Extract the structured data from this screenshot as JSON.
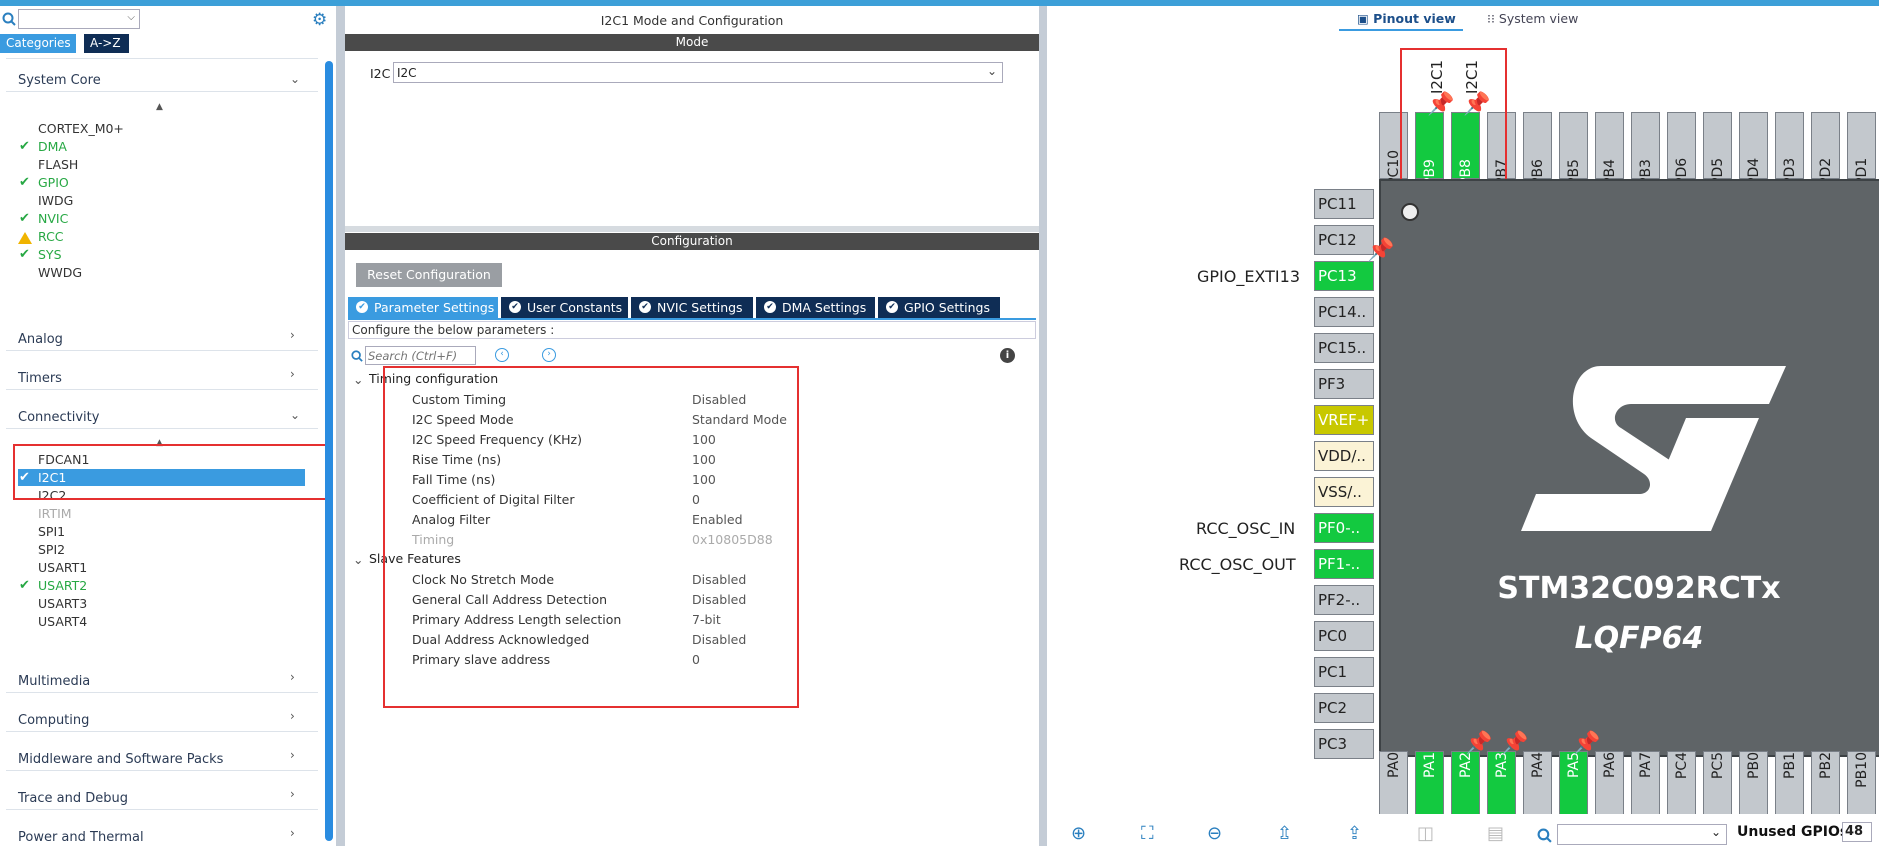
{
  "left": {
    "categories_tab": "Categories",
    "az_tab": "A->Z",
    "sections": {
      "system_core": "System Core",
      "analog": "Analog",
      "timers": "Timers",
      "connectivity": "Connectivity",
      "multimedia": "Multimedia",
      "computing": "Computing",
      "middleware": "Middleware and Software Packs",
      "trace": "Trace and Debug",
      "power": "Power and Thermal"
    },
    "system_core_items": [
      "CORTEX_M0+",
      "DMA",
      "FLASH",
      "GPIO",
      "IWDG",
      "NVIC",
      "RCC",
      "SYS",
      "WWDG"
    ],
    "connectivity_items": [
      "FDCAN1",
      "I2C1",
      "I2C2",
      "IRTIM",
      "SPI1",
      "SPI2",
      "USART1",
      "USART2",
      "USART3",
      "USART4"
    ]
  },
  "mid": {
    "title": "I2C1 Mode and Configuration",
    "mode_header": "Mode",
    "mode_label": "I2C",
    "mode_value": "I2C",
    "config_header": "Configuration",
    "reset_btn": "Reset Configuration",
    "tabs": [
      "Parameter Settings",
      "User Constants",
      "NVIC Settings",
      "DMA Settings",
      "GPIO Settings"
    ],
    "configure_text": "Configure the below parameters :",
    "search_placeholder": "Search (Ctrl+F)",
    "group1": "Timing configuration",
    "group2": "Slave Features",
    "params1": [
      {
        "label": "Custom Timing",
        "value": "Disabled"
      },
      {
        "label": "I2C Speed Mode",
        "value": "Standard Mode"
      },
      {
        "label": "I2C Speed Frequency (KHz)",
        "value": "100"
      },
      {
        "label": "Rise Time (ns)",
        "value": "100"
      },
      {
        "label": "Fall Time (ns)",
        "value": "100"
      },
      {
        "label": "Coefficient of Digital Filter",
        "value": "0"
      },
      {
        "label": "Analog Filter",
        "value": "Enabled"
      },
      {
        "label": "Timing",
        "value": "0x10805D88"
      }
    ],
    "params2": [
      {
        "label": "Clock No Stretch Mode",
        "value": "Disabled"
      },
      {
        "label": "General Call Address Detection",
        "value": "Disabled"
      },
      {
        "label": "Primary Address Length selection",
        "value": "7-bit"
      },
      {
        "label": "Dual Address Acknowledged",
        "value": "Disabled"
      },
      {
        "label": "Primary slave address",
        "value": "0"
      }
    ]
  },
  "right": {
    "pinout_view": "Pinout view",
    "system_view": "System view",
    "top_pins": [
      "PC10",
      "PB9",
      "PB8",
      "PB7",
      "PB6",
      "PB5",
      "PB4",
      "PB3",
      "PD6",
      "PD5",
      "PD4",
      "PD3",
      "PD2",
      "PD1"
    ],
    "top_labels": [
      "I2C1",
      "I2C1"
    ],
    "left_pins": [
      "PC11",
      "PC12",
      "PC13",
      "PC14..",
      "PC15..",
      "PF3",
      "VREF+",
      "VDD/..",
      "VSS/..",
      "PF0-..",
      "PF1-..",
      "PF2-..",
      "PC0",
      "PC1",
      "PC2",
      "PC3"
    ],
    "left_labels": [
      "GPIO_EXTI13",
      "RCC_OSC_IN",
      "RCC_OSC_OUT"
    ],
    "bottom_pins": [
      "PA0",
      "PA1",
      "PA2",
      "PA3",
      "PA4",
      "PA5",
      "PA6",
      "PA7",
      "PC4",
      "PC5",
      "PB0",
      "PB1",
      "PB2",
      "PB10"
    ],
    "chip_name": "STM32C092RCTx",
    "chip_package": "LQFP64",
    "unused_label": "Unused GPIOs:",
    "unused_value": "48"
  }
}
